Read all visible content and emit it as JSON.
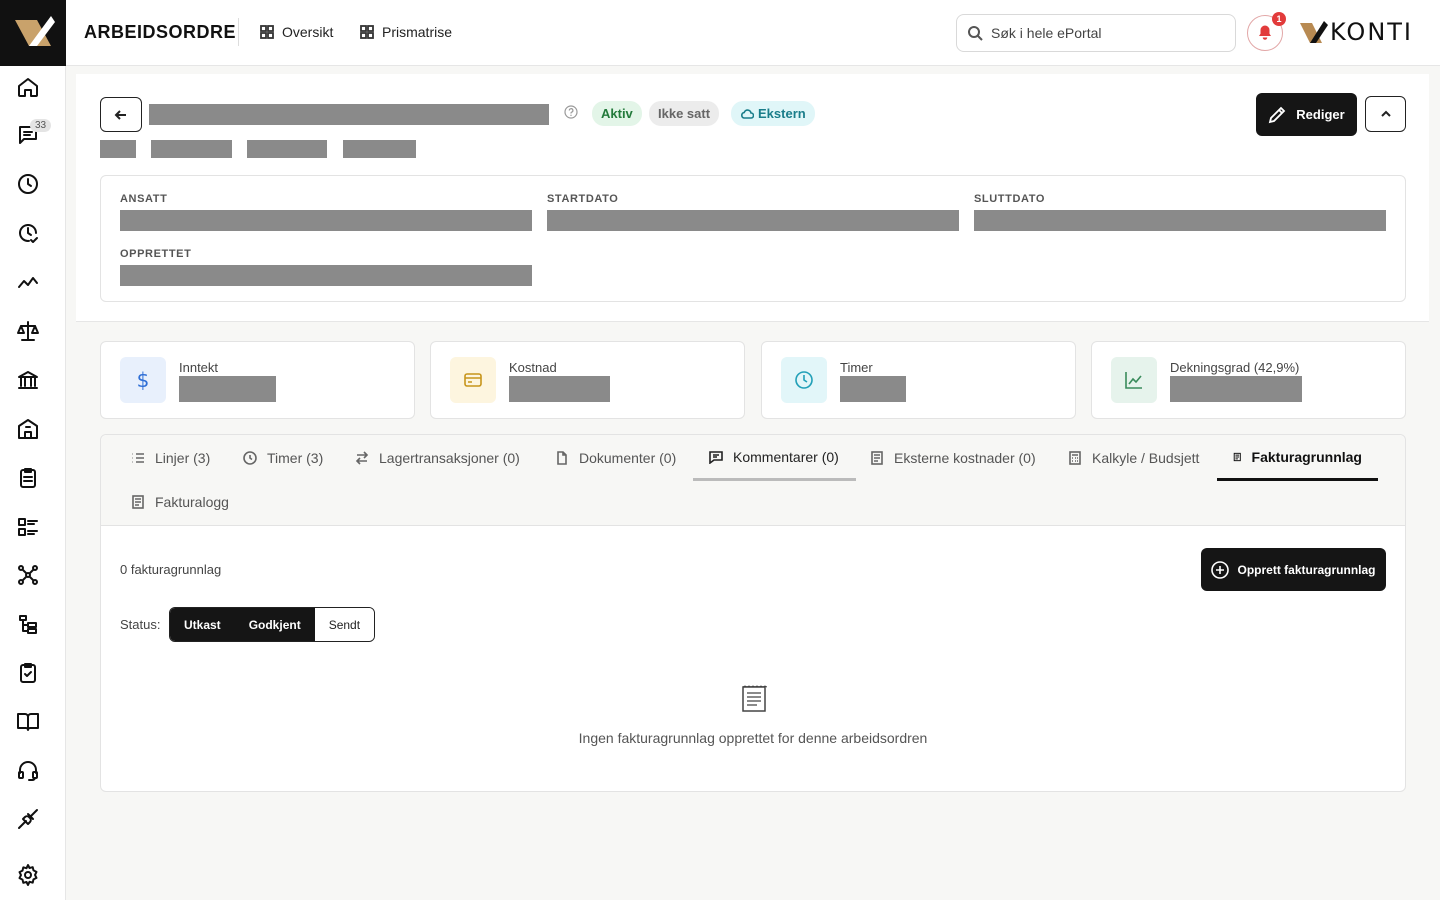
{
  "sidebar": {
    "badge_count": "33",
    "icons": [
      "home-icon",
      "chat-icon",
      "clock-icon",
      "clock-check-icon",
      "trend-icon",
      "scale-icon",
      "bank-icon",
      "building-icon",
      "clipboard-icon",
      "list-icon",
      "network-icon",
      "tree-icon",
      "clipboard-check-icon",
      "book-icon",
      "headset-icon",
      "plug-icon",
      "gear-icon"
    ]
  },
  "topbar": {
    "title": "ARBEIDSORDRE",
    "nav": [
      "Oversikt",
      "Prismatrise"
    ],
    "search_placeholder": "Søk i hele ePortal",
    "notification_count": "1",
    "brand": "KONTI"
  },
  "header": {
    "badges": {
      "status": "Aktiv",
      "second": "Ikke satt",
      "type": "Ekstern"
    },
    "edit_label": "Rediger",
    "fields": {
      "employee": "ANSATT",
      "start": "STARTDATO",
      "end": "SLUTTDATO",
      "created": "OPPRETTET"
    }
  },
  "stats": [
    {
      "label": "Inntekt",
      "icon": "dollar-icon",
      "color": "#2f6fd6",
      "bg": "#e8f0fc"
    },
    {
      "label": "Kostnad",
      "icon": "card-icon",
      "color": "#c7951c",
      "bg": "#fdf5df"
    },
    {
      "label": "Timer",
      "icon": "clock-icon",
      "color": "#22a0b8",
      "bg": "#e2f6f9"
    },
    {
      "label": "Dekningsgrad (42,9%)",
      "icon": "chart-icon",
      "color": "#3a8b5c",
      "bg": "#e6f3ec"
    }
  ],
  "tabs": [
    {
      "label": "Linjer (3)"
    },
    {
      "label": "Timer (3)"
    },
    {
      "label": "Lagertransaksjoner (0)"
    },
    {
      "label": "Dokumenter (0)"
    },
    {
      "label": "Kommentarer (0)"
    },
    {
      "label": "Eksterne kostnader (0)"
    },
    {
      "label": "Kalkyle / Budsjett"
    },
    {
      "label": "Fakturagrunnlag"
    },
    {
      "label": "Fakturalogg"
    }
  ],
  "invoice": {
    "count_text": "0 fakturagrunnlag",
    "create_label": "Opprett fakturagrunnlag",
    "status_label": "Status:",
    "filters": [
      "Utkast",
      "Godkjent",
      "Sendt"
    ],
    "empty_text": "Ingen fakturagrunnlag opprettet for denne arbeidsordren"
  }
}
